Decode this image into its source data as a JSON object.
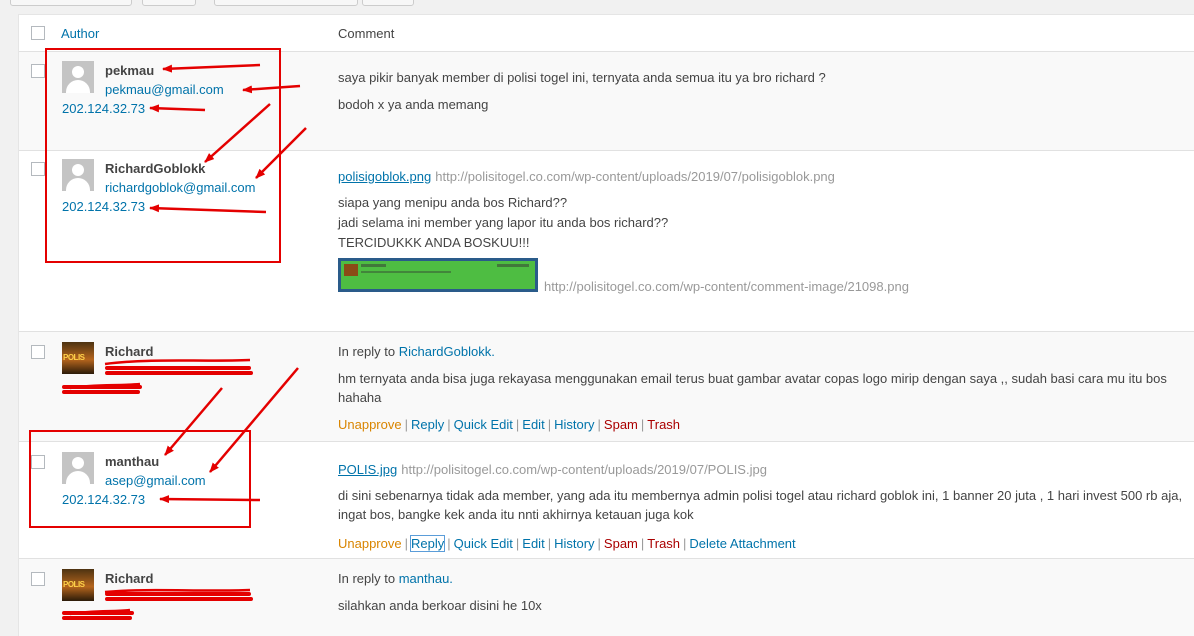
{
  "header": {
    "author_label": "Author",
    "comment_label": "Comment"
  },
  "comments": [
    {
      "author": "pekmau",
      "email": "pekmau@gmail.com",
      "ip": "202.124.32.73",
      "lines": [
        "saya pikir banyak member di polisi togel ini, ternyata anda semua itu ya bro richard ?",
        "bodoh x ya anda memang"
      ]
    },
    {
      "author": "RichardGoblokk",
      "email": "richardgoblok@gmail.com",
      "ip": "202.124.32.73",
      "file_name": "polisigoblok.png",
      "file_url": "http://polisitogel.co.com/wp-content/uploads/2019/07/polisigoblok.png",
      "lines": [
        "siapa yang menipu anda bos Richard??",
        "jadi selama ini member yang lapor itu anda bos richard??",
        "TERCIDUKKK ANDA BOSKUU!!!"
      ],
      "image_url": "http://polisitogel.co.com/wp-content/comment-image/21098.png"
    },
    {
      "author": "Richard",
      "avatar_text": "POLIS",
      "reply_prefix": "In reply to",
      "reply_to": "RichardGoblokk.",
      "lines": [
        "hm ternyata anda bisa juga rekayasa menggunakan email terus buat gambar avatar copas logo mirip dengan saya ,, sudah basi cara mu itu bos",
        "hahaha"
      ]
    },
    {
      "author": "manthau",
      "email": "asep@gmail.com",
      "ip": "202.124.32.73",
      "file_name": "POLIS.jpg",
      "file_url": "http://polisitogel.co.com/wp-content/uploads/2019/07/POLIS.jpg",
      "lines": [
        "di sini sebenarnya tidak ada member, yang ada itu membernya admin polisi togel atau richard goblok ini, 1 banner 20 juta , 1 hari invest 500 rb aja,",
        "ingat bos, bangke kek anda itu nnti akhirnya ketauan juga kok"
      ]
    },
    {
      "author": "Richard",
      "avatar_text": "POLIS",
      "reply_prefix": "In reply to",
      "reply_to": "manthau.",
      "lines": [
        "silahkan anda berkoar disini he 10x"
      ]
    }
  ],
  "row_actions": {
    "unapprove": "Unapprove",
    "reply": "Reply",
    "quick_edit": "Quick Edit",
    "edit": "Edit",
    "history": "History",
    "spam": "Spam",
    "trash": "Trash",
    "delete_attachment": "Delete Attachment"
  },
  "colors": {
    "link": "#0073aa",
    "unapprove": "#d98500",
    "danger": "#a00000",
    "annotation": "#e40000"
  }
}
